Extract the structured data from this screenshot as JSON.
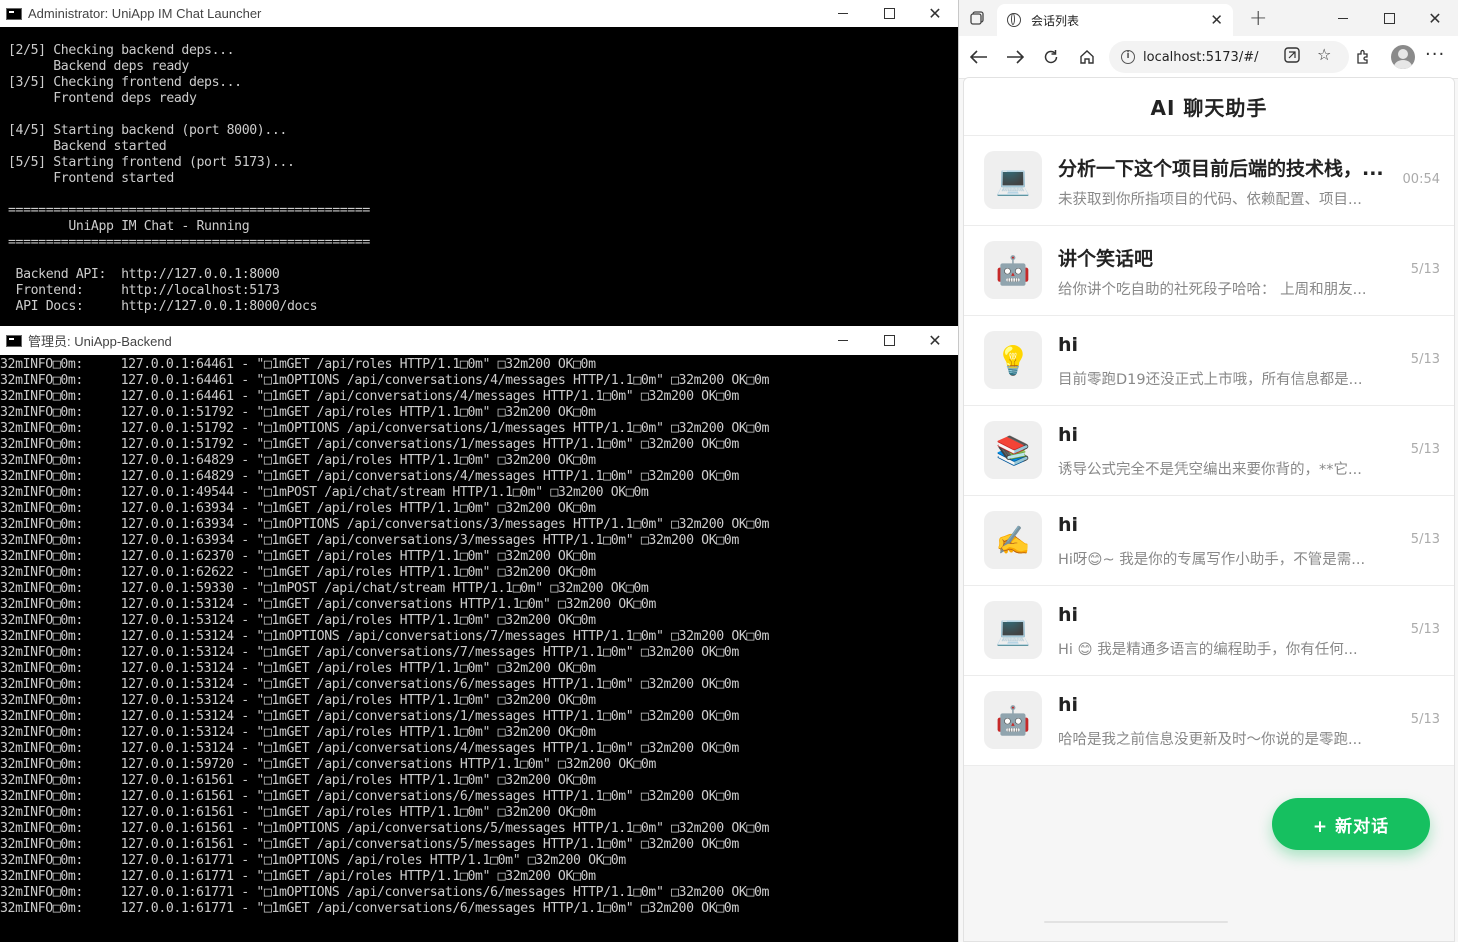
{
  "launcher": {
    "title": "Administrator:  UniApp IM Chat Launcher",
    "lines": [
      "[2/5] Checking backend deps...",
      "      Backend deps ready",
      "[3/5] Checking frontend deps...",
      "      Frontend deps ready",
      "",
      "[4/5] Starting backend (port 8000)...",
      "      Backend started",
      "[5/5] Starting frontend (port 5173)...",
      "      Frontend started",
      "",
      "================================================",
      "        UniApp IM Chat - Running",
      "================================================",
      "",
      " Backend API:  http://127.0.0.1:8000",
      " Frontend:     http://localhost:5173",
      " API Docs:     http://127.0.0.1:8000/docs"
    ]
  },
  "backend": {
    "title": "管理员:  UniApp-Backend",
    "lines": [
      "32mINFO□0m:     127.0.0.1:64461 - \"□1mGET /api/roles HTTP/1.1□0m\" □32m200 OK□0m",
      "32mINFO□0m:     127.0.0.1:64461 - \"□1mOPTIONS /api/conversations/4/messages HTTP/1.1□0m\" □32m200 OK□0m",
      "32mINFO□0m:     127.0.0.1:64461 - \"□1mGET /api/conversations/4/messages HTTP/1.1□0m\" □32m200 OK□0m",
      "32mINFO□0m:     127.0.0.1:51792 - \"□1mGET /api/roles HTTP/1.1□0m\" □32m200 OK□0m",
      "32mINFO□0m:     127.0.0.1:51792 - \"□1mOPTIONS /api/conversations/1/messages HTTP/1.1□0m\" □32m200 OK□0m",
      "32mINFO□0m:     127.0.0.1:51792 - \"□1mGET /api/conversations/1/messages HTTP/1.1□0m\" □32m200 OK□0m",
      "32mINFO□0m:     127.0.0.1:64829 - \"□1mGET /api/roles HTTP/1.1□0m\" □32m200 OK□0m",
      "32mINFO□0m:     127.0.0.1:64829 - \"□1mGET /api/conversations/4/messages HTTP/1.1□0m\" □32m200 OK□0m",
      "32mINFO□0m:     127.0.0.1:49544 - \"□1mPOST /api/chat/stream HTTP/1.1□0m\" □32m200 OK□0m",
      "32mINFO□0m:     127.0.0.1:63934 - \"□1mGET /api/roles HTTP/1.1□0m\" □32m200 OK□0m",
      "32mINFO□0m:     127.0.0.1:63934 - \"□1mOPTIONS /api/conversations/3/messages HTTP/1.1□0m\" □32m200 OK□0m",
      "32mINFO□0m:     127.0.0.1:63934 - \"□1mGET /api/conversations/3/messages HTTP/1.1□0m\" □32m200 OK□0m",
      "32mINFO□0m:     127.0.0.1:62370 - \"□1mGET /api/roles HTTP/1.1□0m\" □32m200 OK□0m",
      "32mINFO□0m:     127.0.0.1:62622 - \"□1mGET /api/roles HTTP/1.1□0m\" □32m200 OK□0m",
      "32mINFO□0m:     127.0.0.1:59330 - \"□1mPOST /api/chat/stream HTTP/1.1□0m\" □32m200 OK□0m",
      "32mINFO□0m:     127.0.0.1:53124 - \"□1mGET /api/conversations HTTP/1.1□0m\" □32m200 OK□0m",
      "32mINFO□0m:     127.0.0.1:53124 - \"□1mGET /api/roles HTTP/1.1□0m\" □32m200 OK□0m",
      "32mINFO□0m:     127.0.0.1:53124 - \"□1mOPTIONS /api/conversations/7/messages HTTP/1.1□0m\" □32m200 OK□0m",
      "32mINFO□0m:     127.0.0.1:53124 - \"□1mGET /api/conversations/7/messages HTTP/1.1□0m\" □32m200 OK□0m",
      "32mINFO□0m:     127.0.0.1:53124 - \"□1mGET /api/roles HTTP/1.1□0m\" □32m200 OK□0m",
      "32mINFO□0m:     127.0.0.1:53124 - \"□1mGET /api/conversations/6/messages HTTP/1.1□0m\" □32m200 OK□0m",
      "32mINFO□0m:     127.0.0.1:53124 - \"□1mGET /api/roles HTTP/1.1□0m\" □32m200 OK□0m",
      "32mINFO□0m:     127.0.0.1:53124 - \"□1mGET /api/conversations/1/messages HTTP/1.1□0m\" □32m200 OK□0m",
      "32mINFO□0m:     127.0.0.1:53124 - \"□1mGET /api/roles HTTP/1.1□0m\" □32m200 OK□0m",
      "32mINFO□0m:     127.0.0.1:53124 - \"□1mGET /api/conversations/4/messages HTTP/1.1□0m\" □32m200 OK□0m",
      "32mINFO□0m:     127.0.0.1:59720 - \"□1mGET /api/conversations HTTP/1.1□0m\" □32m200 OK□0m",
      "32mINFO□0m:     127.0.0.1:61561 - \"□1mGET /api/roles HTTP/1.1□0m\" □32m200 OK□0m",
      "32mINFO□0m:     127.0.0.1:61561 - \"□1mGET /api/conversations/6/messages HTTP/1.1□0m\" □32m200 OK□0m",
      "32mINFO□0m:     127.0.0.1:61561 - \"□1mGET /api/roles HTTP/1.1□0m\" □32m200 OK□0m",
      "32mINFO□0m:     127.0.0.1:61561 - \"□1mOPTIONS /api/conversations/5/messages HTTP/1.1□0m\" □32m200 OK□0m",
      "32mINFO□0m:     127.0.0.1:61561 - \"□1mGET /api/conversations/5/messages HTTP/1.1□0m\" □32m200 OK□0m",
      "32mINFO□0m:     127.0.0.1:61771 - \"□1mOPTIONS /api/roles HTTP/1.1□0m\" □32m200 OK□0m",
      "32mINFO□0m:     127.0.0.1:61771 - \"□1mGET /api/roles HTTP/1.1□0m\" □32m200 OK□0m",
      "32mINFO□0m:     127.0.0.1:61771 - \"□1mOPTIONS /api/conversations/6/messages HTTP/1.1□0m\" □32m200 OK□0m",
      "32mINFO□0m:     127.0.0.1:61771 - \"□1mGET /api/conversations/6/messages HTTP/1.1□0m\" □32m200 OK□0m"
    ]
  },
  "browser": {
    "tab_title": "会话列表",
    "url": "localhost:5173/#/",
    "page": {
      "title": "AI 聊天助手",
      "new_chat_label": "+ 新对话",
      "accent": "#16c060",
      "conversations": [
        {
          "avatar": "💻",
          "title": "分析一下这个项目前后端的技术栈，...",
          "preview": "未获取到你所指项目的代码、依赖配置、项目...",
          "time": "00:54"
        },
        {
          "avatar": "🤖",
          "title": "讲个笑话吧",
          "preview": "给你讲个吃自助的社死段子哈哈： 上周和朋友...",
          "time": "5/13"
        },
        {
          "avatar": "💡",
          "title": "hi",
          "preview": "目前零跑D19还没正式上市哦，所有信息都是...",
          "time": "5/13"
        },
        {
          "avatar": "📚",
          "title": "hi",
          "preview": "诱导公式完全不是凭空编出来要你背的，**它...",
          "time": "5/13"
        },
        {
          "avatar": "✍️",
          "title": "hi",
          "preview": "Hi呀😊~ 我是你的专属写作小助手，不管是需...",
          "time": "5/13"
        },
        {
          "avatar": "💻",
          "title": "hi",
          "preview": "Hi 😊 我是精通多语言的编程助手，你有任何...",
          "time": "5/13"
        },
        {
          "avatar": "🤖",
          "title": "hi",
          "preview": "哈哈是我之前信息没更新及时～你说的是零跑...",
          "time": "5/13"
        }
      ]
    }
  }
}
